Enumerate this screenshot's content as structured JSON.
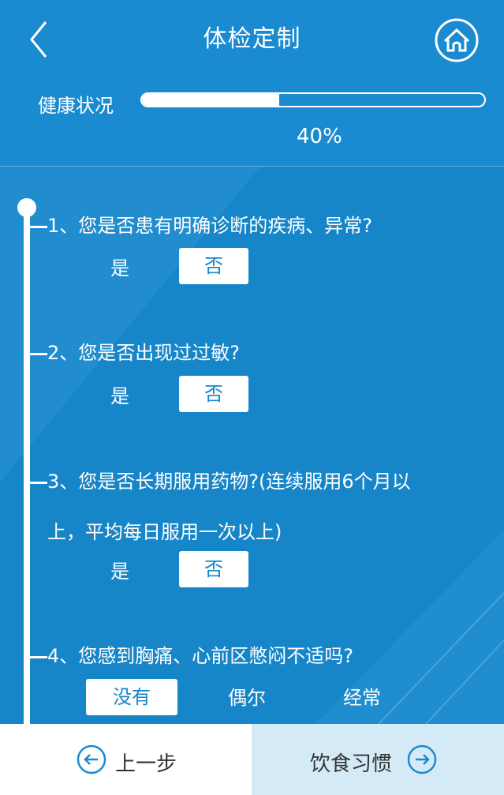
{
  "header": {
    "title": "体检定制",
    "back_icon": "chevron-left-icon",
    "home_icon": "home-icon"
  },
  "progress": {
    "label": "健康状况",
    "percent_text": "40%",
    "value": 0.4
  },
  "questions": [
    {
      "text": "1、您是否患有明确诊断的疾病、异常?",
      "options": [
        "是",
        "否"
      ],
      "selected": "否"
    },
    {
      "text": "2、您是否出现过过敏?",
      "options": [
        "是",
        "否"
      ],
      "selected": "否"
    },
    {
      "text": "3、您是否长期服用药物?(连续服用6个月以",
      "text_cont": "上，平均每日服用一次以上)",
      "options": [
        "是",
        "否"
      ],
      "selected": "否"
    },
    {
      "text": "4、您感到胸痛、心前区憋闷不适吗?",
      "options": [
        "没有",
        "偶尔",
        "经常"
      ],
      "selected": "没有"
    }
  ],
  "footer": {
    "prev_label": "上一步",
    "next_label": "饮食习惯",
    "prev_icon": "arrow-left-circle-icon",
    "next_icon": "arrow-right-circle-icon"
  },
  "colors": {
    "background": "#1786c9",
    "header": "#1a8bd0",
    "accent": "#1786c9",
    "footer_next": "#d4ebf7"
  }
}
